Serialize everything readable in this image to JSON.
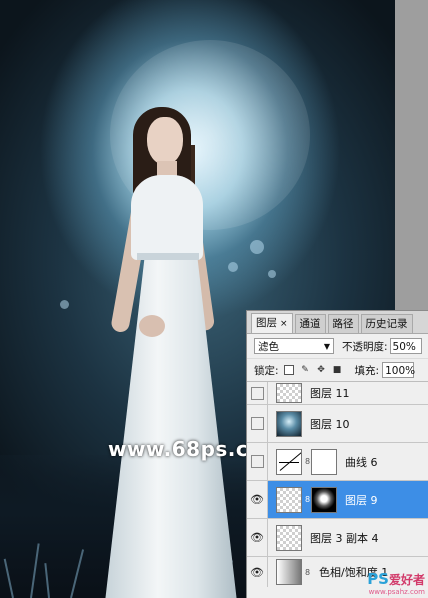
{
  "watermark": {
    "text": "www.68ps.com"
  },
  "panel": {
    "tabs": [
      {
        "label": "图层",
        "close": "×"
      },
      {
        "label": "通道"
      },
      {
        "label": "路径"
      },
      {
        "label": "历史记录"
      }
    ],
    "blend_mode": "滤色",
    "opacity_label": "不透明度:",
    "opacity_value": "50%",
    "lock_label": "锁定:",
    "fill_label": "填充:",
    "fill_value": "100%",
    "layers": [
      {
        "name": "图层 11",
        "visible": false,
        "thumb": "transparent",
        "selected": false
      },
      {
        "name": "图层 10",
        "visible": false,
        "thumb": "photo",
        "selected": false
      },
      {
        "name": "曲线 6",
        "visible": false,
        "thumb": "curves",
        "mask": "white",
        "selected": false
      },
      {
        "name": "图层 9",
        "visible": true,
        "thumb": "transparent",
        "mask": "glow",
        "selected": true
      },
      {
        "name": "图层 3 副本 4",
        "visible": true,
        "thumb": "transparent",
        "selected": false
      },
      {
        "name": "色相/饱和度 1",
        "visible": true,
        "thumb": "huesat",
        "selected": false
      }
    ]
  },
  "logo": {
    "ps": "PS",
    "cn": "爱好者",
    "url": "www.psahz.com"
  },
  "colors": {
    "selection": "#3d8ee6",
    "panel_bg": "#efefef",
    "glow": "#d8f0fb"
  }
}
